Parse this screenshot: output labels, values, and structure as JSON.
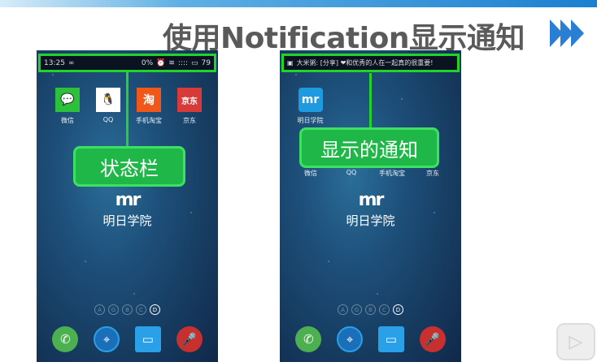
{
  "slide_title": "使用Notification显示通知",
  "left_phone": {
    "status": {
      "time": "13:25",
      "infinity": "∞",
      "battery_pct_text": "0%",
      "signal": "::::",
      "battery": "79"
    },
    "apps": [
      {
        "label": "微信",
        "glyph": "💬",
        "color": "#2dc03a"
      },
      {
        "label": "QQ",
        "glyph": "🐧",
        "color": "#ffffff"
      },
      {
        "label": "手机淘宝",
        "glyph": "淘",
        "color": "#f2571a"
      },
      {
        "label": "京东",
        "glyph": "京东",
        "color": "#d83a3a"
      }
    ],
    "callout": "状态栏",
    "brand": {
      "logo": "mr",
      "name": "明日学院"
    },
    "dots": [
      "A",
      "G",
      "B",
      "C",
      "D"
    ]
  },
  "right_phone": {
    "notification": "大米粥: [分享] ❤和优秀的人在一起真的很重要!",
    "new_app": {
      "label": "明日学院",
      "logo": "mr",
      "color": "#1e9be0"
    },
    "apps": [
      {
        "label": "微信"
      },
      {
        "label": "QQ"
      },
      {
        "label": "手机淘宝"
      },
      {
        "label": "京东"
      }
    ],
    "callout": "显示的通知",
    "brand": {
      "logo": "mr",
      "name": "明日学院"
    },
    "dots": [
      "A",
      "G",
      "B",
      "C",
      "D"
    ]
  },
  "dock": [
    {
      "name": "phone",
      "glyph": "✆",
      "color": "#4cb050"
    },
    {
      "name": "browser",
      "glyph": "⌖",
      "color": "#1b6fb8"
    },
    {
      "name": "messages",
      "glyph": "▭",
      "color": "#2aa0e8"
    },
    {
      "name": "voice",
      "glyph": "🎤",
      "color": "#c8302f"
    }
  ]
}
